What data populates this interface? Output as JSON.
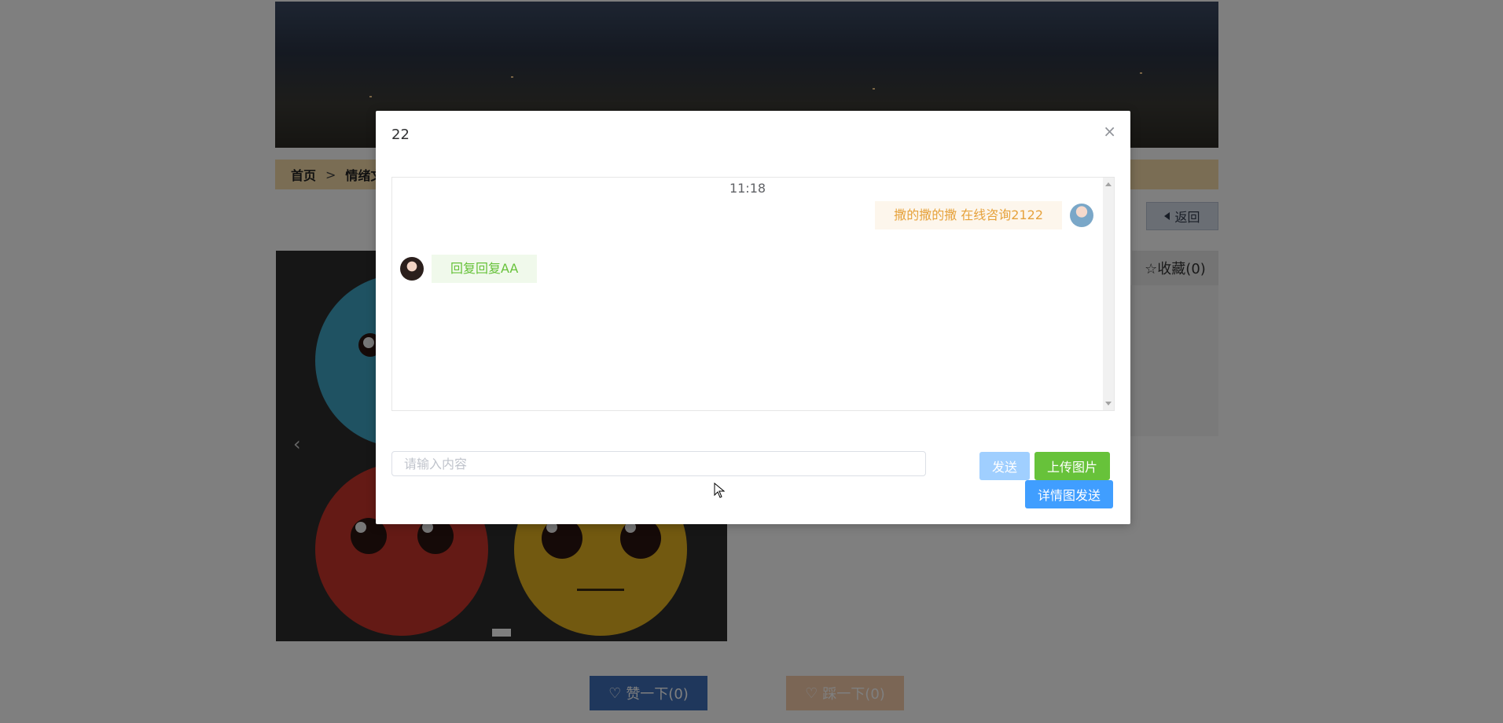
{
  "background": {
    "breadcrumb": {
      "home": "首页",
      "separator": ">",
      "current": "情绪文"
    },
    "back_button": "返回",
    "favorite_button": "☆收藏(0)",
    "like_button": "赞一下(0)",
    "dislike_button": "踩一下(0)",
    "slider_prev": "‹"
  },
  "modal": {
    "title": "22",
    "close": "×",
    "chat": {
      "time": "11:18",
      "messages": [
        {
          "side": "right",
          "text": "撒的撒的撒 在线咨询2122"
        },
        {
          "side": "left",
          "text": "回复回复AA"
        }
      ]
    },
    "input": {
      "placeholder": "请输入内容",
      "value": ""
    },
    "buttons": {
      "send": "发送",
      "upload": "上传图片",
      "detail_send": "详情图发送"
    }
  },
  "colors": {
    "overlay": "rgba(0,0,0,0.5)",
    "send": "#a0cfff",
    "upload": "#67c23a",
    "detail_send": "#409eff",
    "bubble_right_bg": "#fdf6ec",
    "bubble_right_text": "#e6a23c",
    "bubble_left_bg": "#f0f9eb",
    "bubble_left_text": "#67c23a"
  }
}
